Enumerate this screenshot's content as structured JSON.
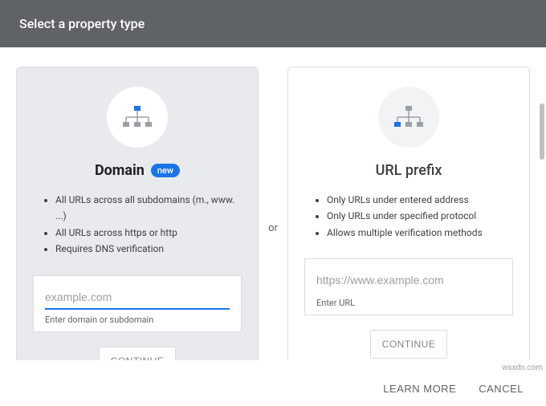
{
  "header": {
    "title": "Select a property type"
  },
  "separator": "or",
  "domain_card": {
    "title": "Domain",
    "badge": "new",
    "bullets": [
      "All URLs across all subdomains (m., www. ...)",
      "All URLs across https or http",
      "Requires DNS verification"
    ],
    "placeholder": "example.com",
    "hint": "Enter domain or subdomain",
    "button": "CONTINUE"
  },
  "url_card": {
    "title": "URL prefix",
    "bullets": [
      "Only URLs under entered address",
      "Only URLs under specified protocol",
      "Allows multiple verification methods"
    ],
    "placeholder": "https://www.example.com",
    "hint": "Enter URL",
    "button": "CONTINUE"
  },
  "footer": {
    "learn_more": "LEARN MORE",
    "cancel": "CANCEL"
  },
  "watermark": "wsxdn.com"
}
